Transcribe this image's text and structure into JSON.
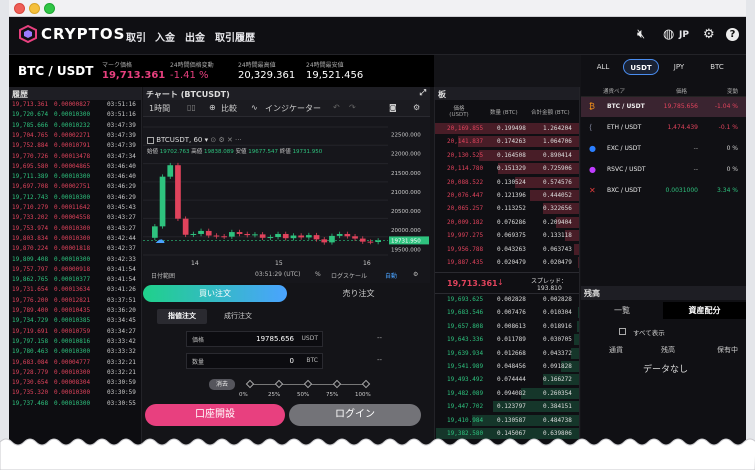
{
  "app": {
    "brand": "CRYPTOS",
    "language": "JP"
  },
  "nav": [
    "取引",
    "入金",
    "出金",
    "取引履歴"
  ],
  "ticker": {
    "pair": "BTC / USDT",
    "mark_label": "マーク価格",
    "mark_value": "19,713.361",
    "change_label": "24時間価格変動",
    "change_value": "-1.41 %",
    "high_label": "24時間最高値",
    "high_value": "20,329.361",
    "low_label": "24時間最安値",
    "low_value": "19,521.456"
  },
  "history": {
    "title": "履歴",
    "rows": [
      {
        "p": "19,713.361",
        "a": "0.00000827",
        "t": "03:51:16",
        "c": "r"
      },
      {
        "p": "19,720.674",
        "a": "0.00010300",
        "t": "03:51:16",
        "c": "g"
      },
      {
        "p": "19,785.666",
        "a": "0.00010232",
        "t": "03:47:39",
        "c": "g"
      },
      {
        "p": "19,704.765",
        "a": "0.00002271",
        "t": "03:47:39",
        "c": "r"
      },
      {
        "p": "19,752.884",
        "a": "0.00010791",
        "t": "03:47:39",
        "c": "r"
      },
      {
        "p": "19,770.726",
        "a": "0.00013478",
        "t": "03:47:34",
        "c": "r"
      },
      {
        "p": "19,695.580",
        "a": "0.00004865",
        "t": "03:46:40",
        "c": "r"
      },
      {
        "p": "19,711.389",
        "a": "0.00010300",
        "t": "03:46:40",
        "c": "g"
      },
      {
        "p": "19,697.708",
        "a": "0.00002751",
        "t": "03:46:29",
        "c": "r"
      },
      {
        "p": "19,712.743",
        "a": "0.00010300",
        "t": "03:46:29",
        "c": "g"
      },
      {
        "p": "19,710.279",
        "a": "0.00011642",
        "t": "03:45:43",
        "c": "r"
      },
      {
        "p": "19,733.202",
        "a": "0.00004558",
        "t": "03:43:27",
        "c": "r"
      },
      {
        "p": "19,753.974",
        "a": "0.00010300",
        "t": "03:43:27",
        "c": "r"
      },
      {
        "p": "19,803.834",
        "a": "0.00010300",
        "t": "03:42:44",
        "c": "r"
      },
      {
        "p": "19,870.224",
        "a": "0.00001818",
        "t": "03:42:37",
        "c": "r"
      },
      {
        "p": "19,809.408",
        "a": "0.00010300",
        "t": "03:42:33",
        "c": "g"
      },
      {
        "p": "19,757.797",
        "a": "0.00000918",
        "t": "03:41:54",
        "c": "r"
      },
      {
        "p": "19,862.765",
        "a": "0.00010377",
        "t": "03:41:54",
        "c": "g"
      },
      {
        "p": "19,731.654",
        "a": "0.00013634",
        "t": "03:41:26",
        "c": "r"
      },
      {
        "p": "19,776.200",
        "a": "0.00012821",
        "t": "03:37:51",
        "c": "r"
      },
      {
        "p": "19,789.400",
        "a": "0.00010435",
        "t": "03:36:20",
        "c": "r"
      },
      {
        "p": "19,734.729",
        "a": "0.00010385",
        "t": "03:34:45",
        "c": "g"
      },
      {
        "p": "19,719.691",
        "a": "0.00010759",
        "t": "03:34:27",
        "c": "r"
      },
      {
        "p": "19,797.158",
        "a": "0.00010816",
        "t": "03:33:42",
        "c": "g"
      },
      {
        "p": "19,780.463",
        "a": "0.00010300",
        "t": "03:33:32",
        "c": "g"
      },
      {
        "p": "19,683.084",
        "a": "0.00004777",
        "t": "03:32:21",
        "c": "r"
      },
      {
        "p": "19,728.779",
        "a": "0.00010300",
        "t": "03:32:21",
        "c": "r"
      },
      {
        "p": "19,730.654",
        "a": "0.00008304",
        "t": "03:30:59",
        "c": "r"
      },
      {
        "p": "19,735.320",
        "a": "0.00010300",
        "t": "03:30:59",
        "c": "r"
      },
      {
        "p": "19,737.468",
        "a": "0.00010300",
        "t": "03:30:55",
        "c": "g"
      }
    ]
  },
  "chart": {
    "title": "チャート (BTCUSDT)",
    "interval": "1時間",
    "compare": "比較",
    "indicator": "インジケーター",
    "symbol": "BTCUSDT, 60",
    "o_label": "始値",
    "o": "19702.763",
    "h_label": "高値",
    "h": "19838.089",
    "l_label": "安値",
    "l": "19677.547",
    "c_label": "終値",
    "c": "19731.950",
    "y_ticks": [
      "22500.000",
      "22000.000",
      "21500.000",
      "21000.000",
      "20500.000",
      "20000.000",
      "19500.000"
    ],
    "last_price": "19731.950",
    "x_ticks": [
      "14",
      "15",
      "16"
    ],
    "range_label": "日付範囲",
    "time": "03:51:29 (UTC)",
    "percent": "%",
    "log": "ログスケール",
    "auto": "自動"
  },
  "chart_data": {
    "type": "candlestick",
    "ylim": [
      19350,
      22700
    ],
    "closes": [
      20100,
      21400,
      21700,
      20300,
      19880,
      19900,
      19980,
      19860,
      19840,
      19830,
      19950,
      19900,
      19870,
      19890,
      19800,
      19820,
      19900,
      19790,
      19860,
      19810,
      19870,
      19760,
      19680,
      19850,
      19900,
      19840,
      19780,
      19700,
      19690,
      19731
    ]
  },
  "order": {
    "buy_tab": "買い注文",
    "sell_tab": "売り注文",
    "limit": "指値注文",
    "market": "成行注文",
    "price_label": "価格",
    "price_value": "19785.656",
    "price_unit": "USDT",
    "qty_label": "数量",
    "qty_value": "0",
    "qty_unit": "BTC",
    "dash": "--",
    "slider_label": "消去",
    "pct": [
      "0%",
      "25%",
      "50%",
      "75%",
      "100%"
    ],
    "open_btn": "口座開設",
    "login_btn": "ログイン"
  },
  "book": {
    "title": "板",
    "h_price": "価格 (USDT)",
    "h_qty": "数量 (BTC)",
    "h_total": "合計金額 (BTC)",
    "asks": [
      {
        "p": "20,169.855",
        "q": "0.199498",
        "t": "1.264204",
        "d": 1.0
      },
      {
        "p": "20,141.837",
        "q": "0.174263",
        "t": "1.064706",
        "d": 0.84
      },
      {
        "p": "20,130.525",
        "q": "0.164508",
        "t": "0.890414",
        "d": 0.7
      },
      {
        "p": "20,114.780",
        "q": "0.151329",
        "t": "0.725906",
        "d": 0.57
      },
      {
        "p": "20,088.522",
        "q": "0.130524",
        "t": "0.574576",
        "d": 0.45
      },
      {
        "p": "20,076.447",
        "q": "0.121396",
        "t": "0.444052",
        "d": 0.35
      },
      {
        "p": "20,065.257",
        "q": "0.113252",
        "t": "0.322656",
        "d": 0.26
      },
      {
        "p": "20,009.182",
        "q": "0.076286",
        "t": "0.209404",
        "d": 0.17
      },
      {
        "p": "19,997.275",
        "q": "0.069375",
        "t": "0.133118",
        "d": 0.11
      },
      {
        "p": "19,956.788",
        "q": "0.043263",
        "t": "0.063743",
        "d": 0.05
      },
      {
        "p": "19,887.435",
        "q": "0.020479",
        "t": "0.020479",
        "d": 0.02
      }
    ],
    "mark": "19,713.361",
    "mark_arrow": "↓",
    "spread_label": "スプレッド：",
    "spread": "193.810",
    "bids": [
      {
        "p": "19,693.625",
        "q": "0.002828",
        "t": "0.002828",
        "d": 0.01
      },
      {
        "p": "19,683.546",
        "q": "0.007476",
        "t": "0.010304",
        "d": 0.02
      },
      {
        "p": "19,657.808",
        "q": "0.008613",
        "t": "0.018916",
        "d": 0.03
      },
      {
        "p": "19,643.336",
        "q": "0.011789",
        "t": "0.030705",
        "d": 0.05
      },
      {
        "p": "19,639.934",
        "q": "0.012668",
        "t": "0.043372",
        "d": 0.07
      },
      {
        "p": "19,541.989",
        "q": "0.048456",
        "t": "0.091828",
        "d": 0.14
      },
      {
        "p": "19,493.492",
        "q": "0.074444",
        "t": "0.166272",
        "d": 0.26
      },
      {
        "p": "19,482.089",
        "q": "0.094082",
        "t": "0.260354",
        "d": 0.41
      },
      {
        "p": "19,447.702",
        "q": "0.123797",
        "t": "0.384151",
        "d": 0.6
      },
      {
        "p": "19,410.984",
        "q": "0.130587",
        "t": "0.484738",
        "d": 0.75
      },
      {
        "p": "19,382.580",
        "q": "0.145067",
        "t": "0.639806",
        "d": 0.99
      }
    ]
  },
  "markets": {
    "tabs": [
      "ALL",
      "USDT",
      "JPY",
      "BTC"
    ],
    "h_pair": "通貨ペア",
    "h_price": "価格",
    "h_change": "変動",
    "rows": [
      {
        "icon": "₿",
        "icolor": "#f7931a",
        "pair": "BTC / USDT",
        "price": "19,785.656",
        "change": "-1.04 %",
        "cc": "#e0435c"
      },
      {
        "icon": "⟨",
        "icolor": "#8a8fa8",
        "pair": "ETH / USDT",
        "price": "1,474.439",
        "change": "-0.1 %",
        "cc": "#e0435c"
      },
      {
        "icon": "●",
        "icolor": "#2b7fff",
        "pair": "EXC / USDT",
        "price": "--",
        "change": "0 %",
        "cc": "#ccc"
      },
      {
        "icon": "●",
        "icolor": "#c03cff",
        "pair": "RSVC / USDT",
        "price": "--",
        "change": "0 %",
        "cc": "#ccc"
      },
      {
        "icon": "✕",
        "icolor": "#e23b3b",
        "pair": "BXC / USDT",
        "price": "0.0031000",
        "change": "3.34 %",
        "cc": "#2ec27e"
      }
    ]
  },
  "assets": {
    "title": "残高",
    "tab_list": "一覧",
    "tab_alloc": "資産配分",
    "show_all": "すべて表示",
    "h_currency": "通貨",
    "h_balance": "残高",
    "h_holding": "保有中",
    "empty": "データなし"
  },
  "colors": {
    "green": "#2ec27e",
    "red": "#e0435c",
    "pink": "#e8407f"
  }
}
